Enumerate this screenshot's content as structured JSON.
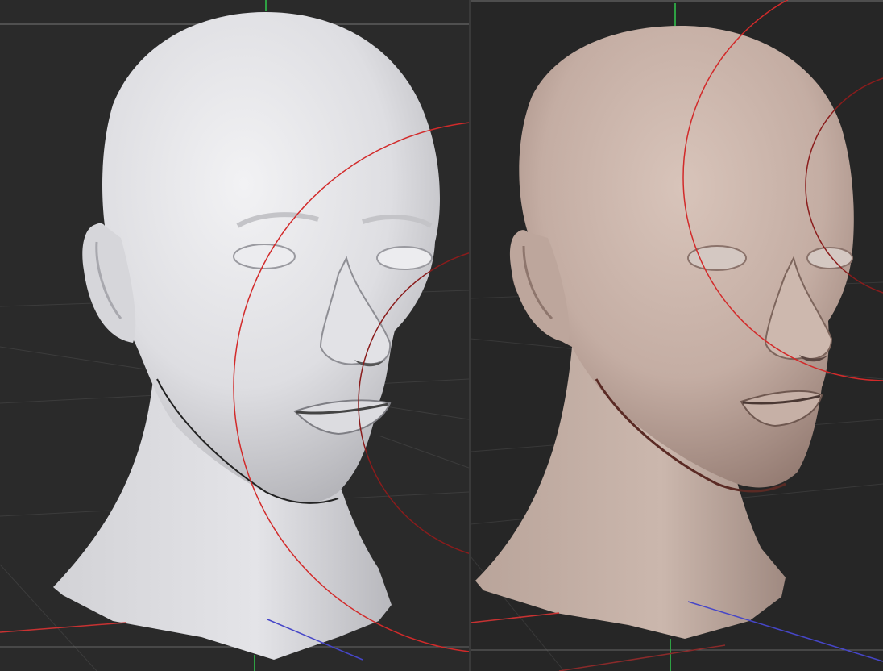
{
  "viewports": [
    {
      "id": "left",
      "shading": "clay-grey",
      "colors": {
        "background": "#2a2a2a",
        "mesh": "#e6e6e8",
        "mesh_shadow": "#9c9ca2"
      }
    },
    {
      "id": "right",
      "shading": "skin-tone",
      "colors": {
        "background": "#262626",
        "mesh": "#c8b2a8",
        "mesh_shadow": "#8d7067"
      }
    }
  ],
  "gizmo_colors": {
    "x_axis": "#c83232",
    "y_axis": "#2ea043",
    "z_axis": "#4646c8",
    "rotate_ring": "#d22a2a",
    "grid": "#3c3c3c",
    "frame_line": "#777777"
  }
}
